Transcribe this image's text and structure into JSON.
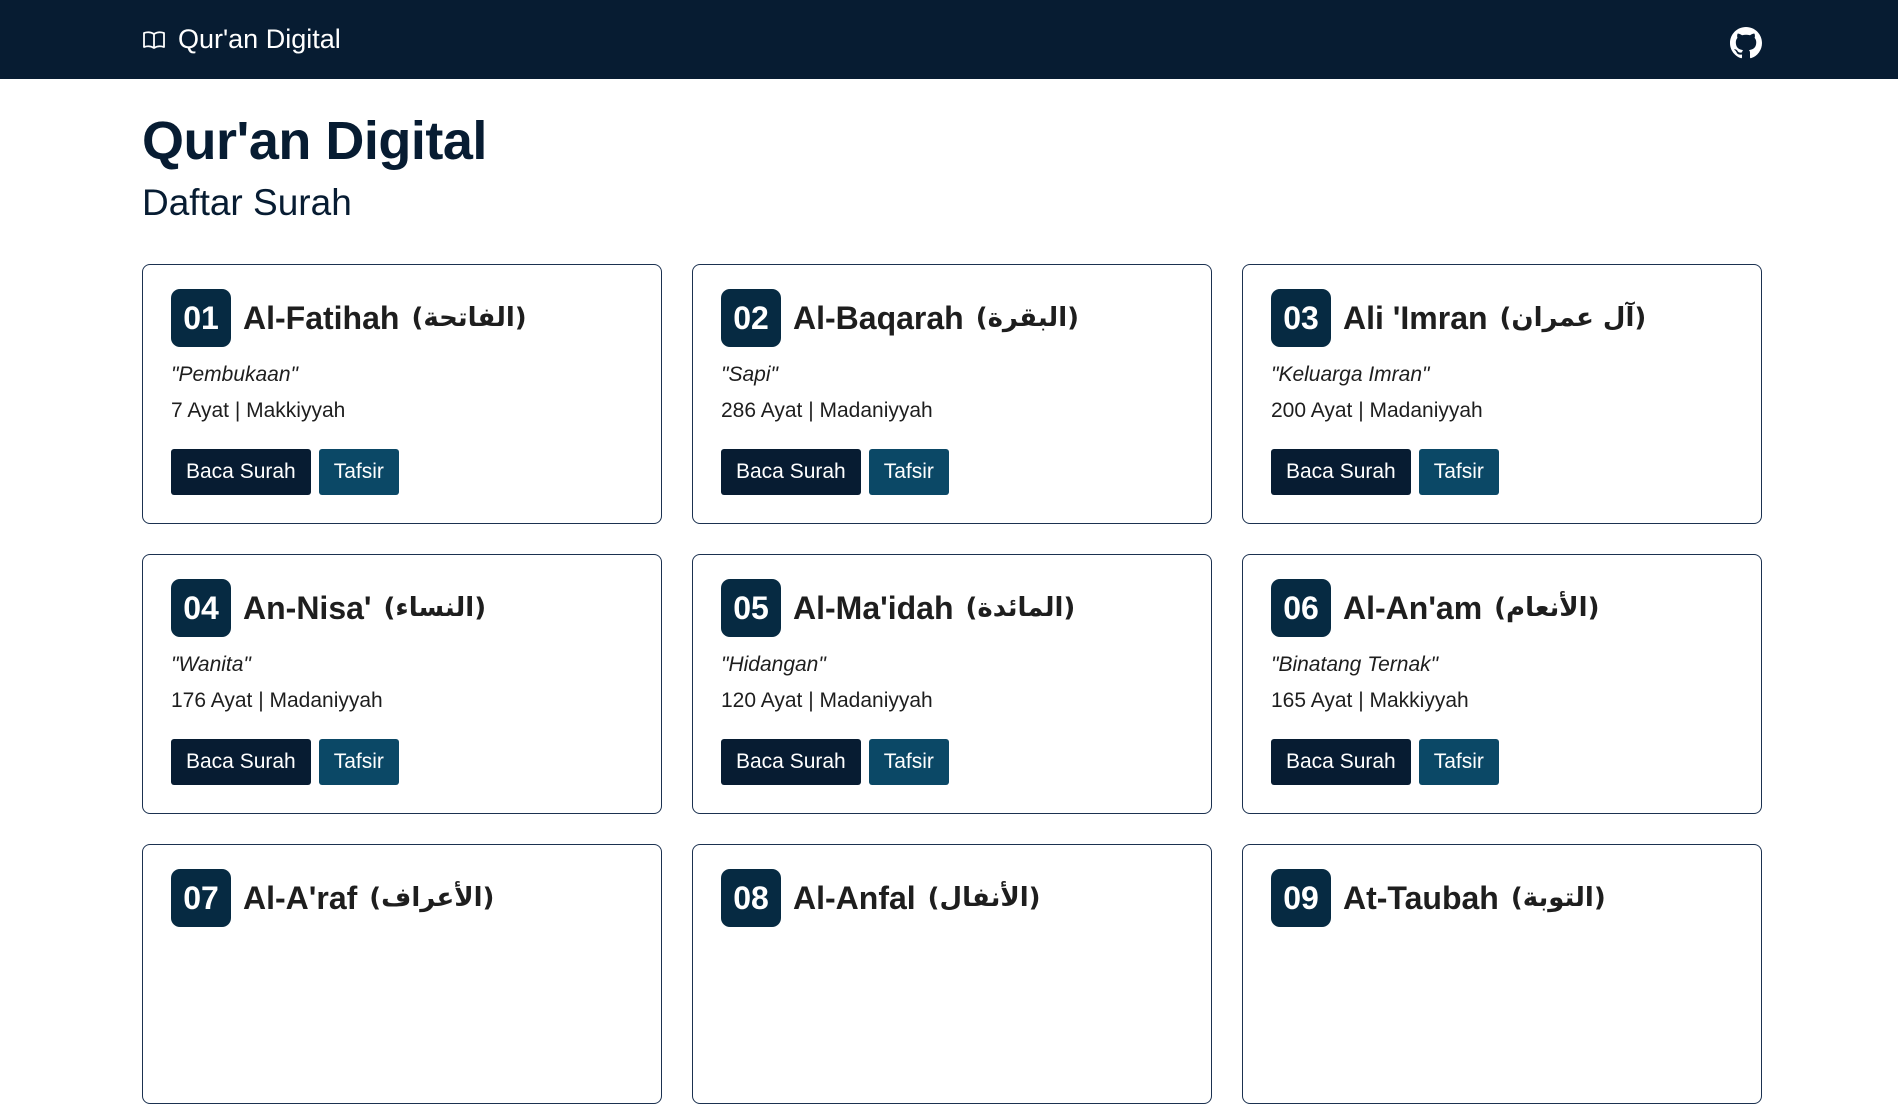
{
  "navbar": {
    "brand": "Qur'an Digital",
    "github_icon": "github-icon",
    "book_icon": "open-book-icon",
    "bg_color": "#071c32"
  },
  "header": {
    "title": "Qur'an Digital",
    "subtitle": "Daftar Surah"
  },
  "buttons": {
    "read": "Baca Surah",
    "tafsir": "Tafsir"
  },
  "colors": {
    "primary": "#071c32",
    "number_badge": "#062a42",
    "tafsir_button": "#0b4866",
    "card_border": "#1b3150"
  },
  "surahs": [
    {
      "number": "01",
      "name": "Al-Fatihah",
      "arabic": "(الفاتحة)",
      "meaning": "\"Pembukaan\"",
      "info": "7 Ayat | Makkiyyah"
    },
    {
      "number": "02",
      "name": "Al-Baqarah",
      "arabic": "(البقرة)",
      "meaning": "\"Sapi\"",
      "info": "286 Ayat | Madaniyyah"
    },
    {
      "number": "03",
      "name": "Ali 'Imran",
      "arabic": "(آل عمران)",
      "meaning": "\"Keluarga Imran\"",
      "info": "200 Ayat | Madaniyyah"
    },
    {
      "number": "04",
      "name": "An-Nisa'",
      "arabic": "(النساء)",
      "meaning": "\"Wanita\"",
      "info": "176 Ayat | Madaniyyah"
    },
    {
      "number": "05",
      "name": "Al-Ma'idah",
      "arabic": "(المائدة)",
      "meaning": "\"Hidangan\"",
      "info": "120 Ayat | Madaniyyah"
    },
    {
      "number": "06",
      "name": "Al-An'am",
      "arabic": "(الأنعام)",
      "meaning": "\"Binatang Ternak\"",
      "info": "165 Ayat | Makkiyyah"
    },
    {
      "number": "07",
      "name": "Al-A'raf",
      "arabic": "(الأعراف)",
      "meaning": "",
      "info": ""
    },
    {
      "number": "08",
      "name": "Al-Anfal",
      "arabic": "(الأنفال)",
      "meaning": "",
      "info": ""
    },
    {
      "number": "09",
      "name": "At-Taubah",
      "arabic": "(التوبة)",
      "meaning": "",
      "info": ""
    }
  ]
}
